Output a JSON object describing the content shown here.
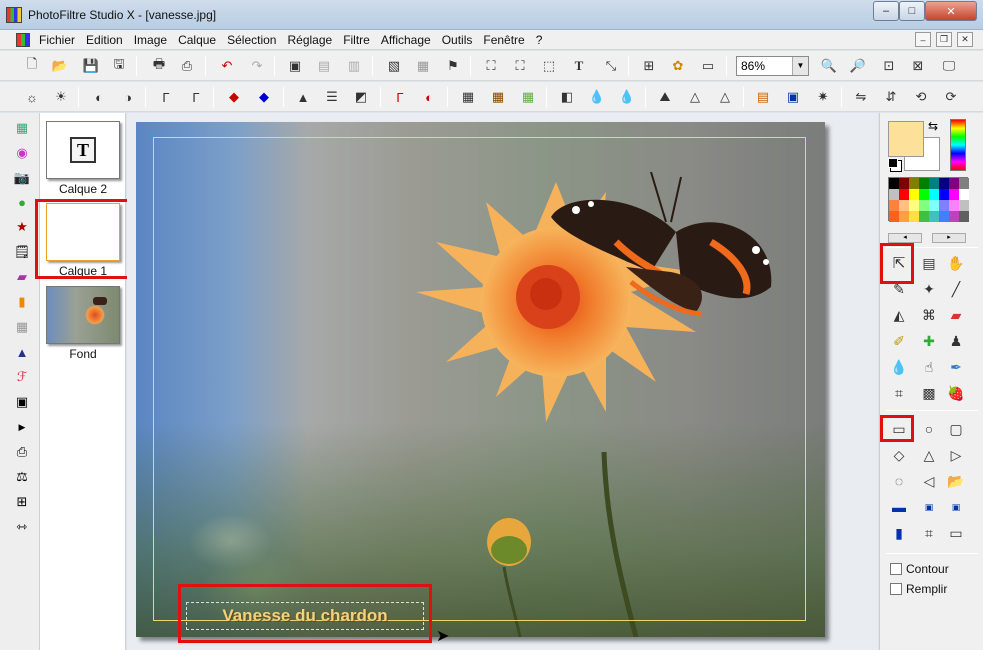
{
  "window": {
    "title": "PhotoFiltre Studio X - [vanesse.jpg]",
    "controls": {
      "minimize": "–",
      "maximize": "□",
      "close": "✕"
    }
  },
  "menu": {
    "items": [
      "Fichier",
      "Edition",
      "Image",
      "Calque",
      "Sélection",
      "Réglage",
      "Filtre",
      "Affichage",
      "Outils",
      "Fenêtre",
      "?"
    ],
    "mdi_controls": {
      "minimize": "–",
      "restore": "❐",
      "close": "✕"
    }
  },
  "toolbar": {
    "zoom_value": "86%",
    "text_tool_glyph": "T"
  },
  "layers": [
    {
      "name": "Calque 2",
      "thumb_glyph": "T"
    },
    {
      "name": "Calque 1"
    },
    {
      "name": "Fond"
    }
  ],
  "canvas": {
    "caption": "Vanesse du chardon"
  },
  "right_panel": {
    "palette_colors": [
      "#000000",
      "#800000",
      "#808000",
      "#008000",
      "#008080",
      "#000080",
      "#800080",
      "#808080",
      "#c0c0c0",
      "#ff0000",
      "#ffff00",
      "#00ff00",
      "#00ffff",
      "#0000ff",
      "#ff00ff",
      "#ffffff",
      "#ff8040",
      "#ffc080",
      "#ffff80",
      "#80ff80",
      "#80ffff",
      "#8080ff",
      "#ff80ff",
      "#c0c0c0",
      "#ff6020",
      "#ffa040",
      "#ffe040",
      "#40c040",
      "#40c0c0",
      "#4080ff",
      "#c040c0",
      "#606060"
    ],
    "options": {
      "contour_label": "Contour",
      "remplir_label": "Remplir"
    }
  }
}
